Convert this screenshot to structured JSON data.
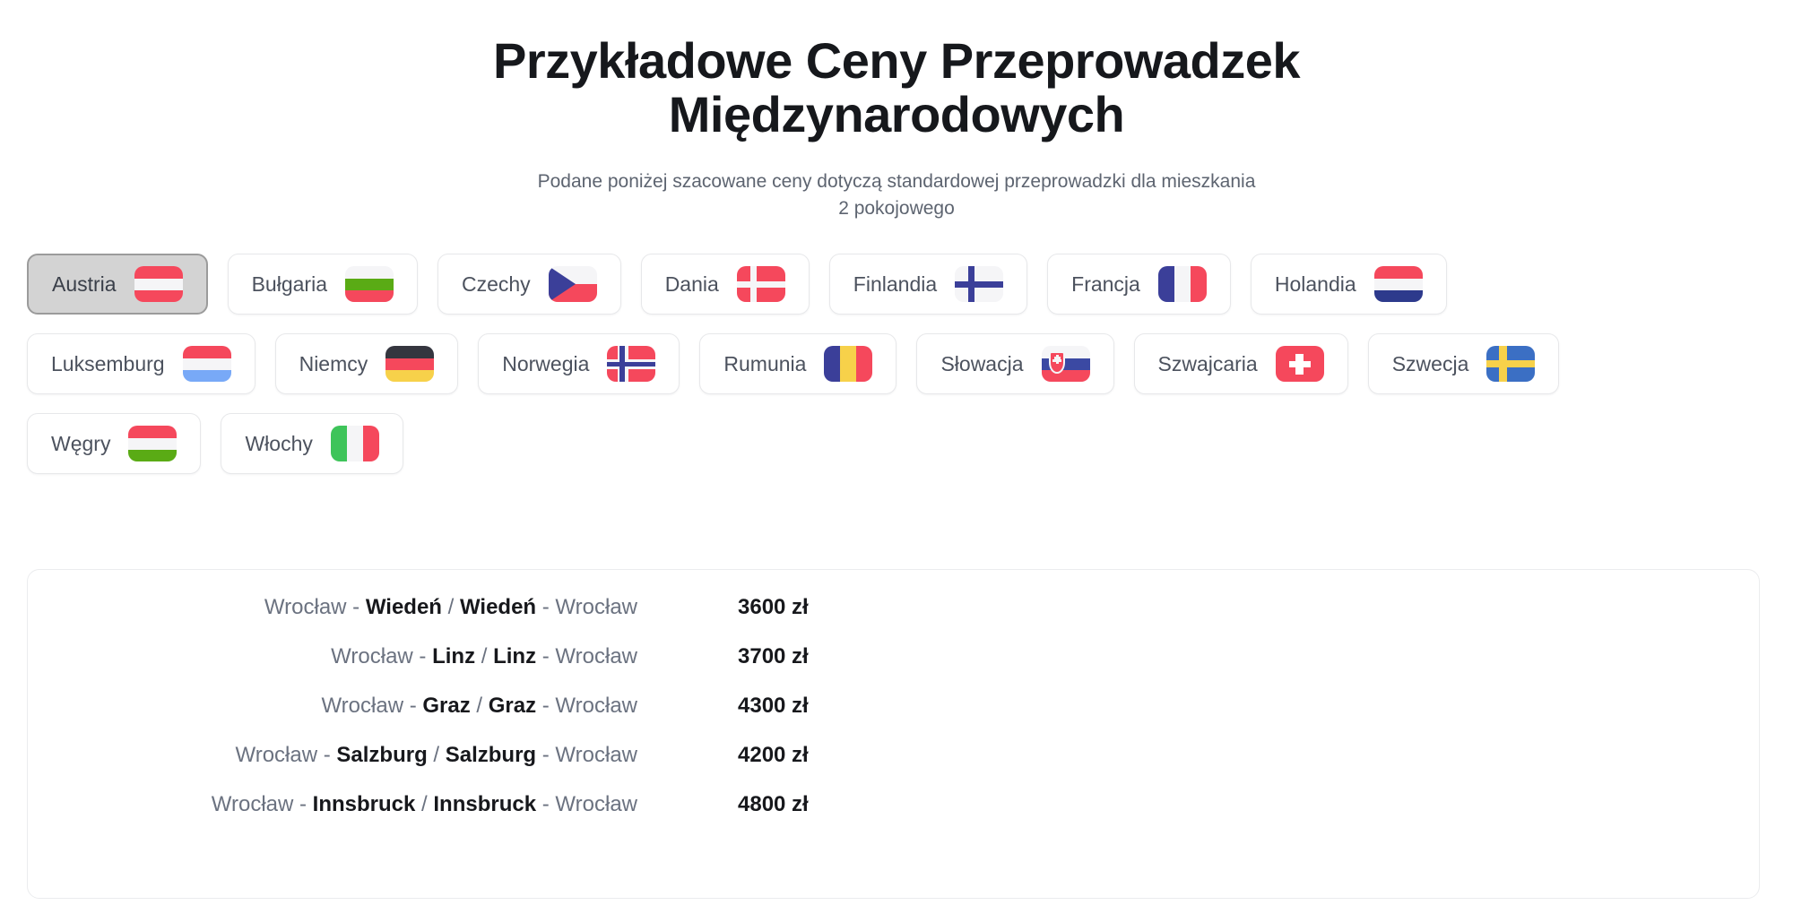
{
  "header": {
    "title_line1": "Przykładowe Ceny Przeprowadzek",
    "title_line2": "Międzynarodowych",
    "subtitle_line1": "Podane poniżej szacowane ceny dotyczą standardowej przeprowadzki dla mieszkania",
    "subtitle_line2": "2 pokojowego"
  },
  "countries": {
    "selected": "Austria",
    "rows": [
      [
        {
          "label": "Austria",
          "flag": "flag-austria",
          "selected": true
        },
        {
          "label": "Bułgaria",
          "flag": "flag-bulgaria",
          "selected": false
        },
        {
          "label": "Czechy",
          "flag": "flag-czechia",
          "selected": false
        },
        {
          "label": "Dania",
          "flag": "flag-denmark",
          "selected": false
        },
        {
          "label": "Finlandia",
          "flag": "flag-finland",
          "selected": false
        },
        {
          "label": "Francja",
          "flag": "flag-france",
          "selected": false
        },
        {
          "label": "Holandia",
          "flag": "flag-netherlands",
          "selected": false
        }
      ],
      [
        {
          "label": "Luksemburg",
          "flag": "flag-luxembourg",
          "selected": false
        },
        {
          "label": "Niemcy",
          "flag": "flag-germany",
          "selected": false
        },
        {
          "label": "Norwegia",
          "flag": "flag-norway",
          "selected": false
        },
        {
          "label": "Rumunia",
          "flag": "flag-romania",
          "selected": false
        },
        {
          "label": "Słowacja",
          "flag": "flag-slovakia",
          "selected": false
        },
        {
          "label": "Szwajcaria",
          "flag": "flag-switzerland",
          "selected": false
        },
        {
          "label": "Szwecja",
          "flag": "flag-sweden",
          "selected": false
        }
      ],
      [
        {
          "label": "Węgry",
          "flag": "flag-hungary",
          "selected": false
        },
        {
          "label": "Włochy",
          "flag": "flag-italy",
          "selected": false
        }
      ]
    ]
  },
  "results": {
    "origin": "Wrocław",
    "currency": "zł",
    "routes": [
      {
        "from": "Wrocław",
        "to": "Wiedeń",
        "price": "3600 zł"
      },
      {
        "from": "Wrocław",
        "to": "Linz",
        "price": "3700 zł"
      },
      {
        "from": "Wrocław",
        "to": "Graz",
        "price": "4300 zł"
      },
      {
        "from": "Wrocław",
        "to": "Salzburg",
        "price": "4200 zł"
      },
      {
        "from": "Wrocław",
        "to": "Innsbruck",
        "price": "4800 zł"
      }
    ]
  },
  "colors": {
    "red": "#f5485c",
    "blue": "#3b3f99",
    "navy": "#2f3899",
    "white": "#f5f5f7",
    "green": "#5aab15",
    "yellow": "#f7d14a",
    "dark": "#35363f",
    "lightblue": "#78a9f7"
  }
}
